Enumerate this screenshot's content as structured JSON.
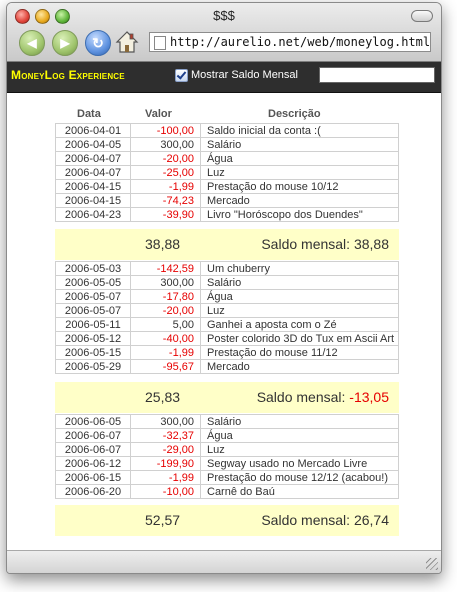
{
  "window": {
    "title": "$$$"
  },
  "browser": {
    "url": "http://aurelio.net/web/moneylog.html"
  },
  "app": {
    "brand": "MoneyLog Experience",
    "monthly_checkbox_label": "Mostrar Saldo Mensal",
    "monthly_checked": true,
    "filter_value": ""
  },
  "table_headers": {
    "date": "Data",
    "value": "Valor",
    "description": "Descrição"
  },
  "colors": {
    "negative": "#e60000",
    "total_bg": "#ffffc8",
    "appbar_bg": "#2e2e2e",
    "brand": "#ffff00"
  },
  "months": [
    {
      "rows": [
        {
          "date": "2006-04-01",
          "value": "-100,00",
          "negative": true,
          "desc": "Saldo inicial da conta :("
        },
        {
          "date": "2006-04-05",
          "value": "300,00",
          "negative": false,
          "desc": "Salário"
        },
        {
          "date": "2006-04-07",
          "value": "-20,00",
          "negative": true,
          "desc": "Água"
        },
        {
          "date": "2006-04-07",
          "value": "-25,00",
          "negative": true,
          "desc": "Luz"
        },
        {
          "date": "2006-04-15",
          "value": "-1,99",
          "negative": true,
          "desc": "Prestação do mouse 10/12"
        },
        {
          "date": "2006-04-15",
          "value": "-74,23",
          "negative": true,
          "desc": "Mercado"
        },
        {
          "date": "2006-04-23",
          "value": "-39,90",
          "negative": true,
          "desc": "Livro \"Horóscopo dos Duendes\""
        }
      ],
      "total": "38,88",
      "saldo_label": "Saldo mensal: ",
      "saldo": "38,88",
      "saldo_negative": false
    },
    {
      "rows": [
        {
          "date": "2006-05-03",
          "value": "-142,59",
          "negative": true,
          "desc": "Um chuberry"
        },
        {
          "date": "2006-05-05",
          "value": "300,00",
          "negative": false,
          "desc": "Salário"
        },
        {
          "date": "2006-05-07",
          "value": "-17,80",
          "negative": true,
          "desc": "Água"
        },
        {
          "date": "2006-05-07",
          "value": "-20,00",
          "negative": true,
          "desc": "Luz"
        },
        {
          "date": "2006-05-11",
          "value": "5,00",
          "negative": false,
          "desc": "Ganhei a aposta com o Zé"
        },
        {
          "date": "2006-05-12",
          "value": "-40,00",
          "negative": true,
          "desc": "Poster colorido 3D do Tux em Ascii Art"
        },
        {
          "date": "2006-05-15",
          "value": "-1,99",
          "negative": true,
          "desc": "Prestação do mouse 11/12"
        },
        {
          "date": "2006-05-29",
          "value": "-95,67",
          "negative": true,
          "desc": "Mercado"
        }
      ],
      "total": "25,83",
      "saldo_label": "Saldo mensal: ",
      "saldo": "-13,05",
      "saldo_negative": true
    },
    {
      "rows": [
        {
          "date": "2006-06-05",
          "value": "300,00",
          "negative": false,
          "desc": "Salário"
        },
        {
          "date": "2006-06-07",
          "value": "-32,37",
          "negative": true,
          "desc": "Água"
        },
        {
          "date": "2006-06-07",
          "value": "-29,00",
          "negative": true,
          "desc": "Luz"
        },
        {
          "date": "2006-06-12",
          "value": "-199,90",
          "negative": true,
          "desc": "Segway usado no Mercado Livre"
        },
        {
          "date": "2006-06-15",
          "value": "-1,99",
          "negative": true,
          "desc": "Prestação do mouse 12/12 (acabou!)"
        },
        {
          "date": "2006-06-20",
          "value": "-10,00",
          "negative": true,
          "desc": "Carnê do Baú"
        }
      ],
      "total": "52,57",
      "saldo_label": "Saldo mensal: ",
      "saldo": "26,74",
      "saldo_negative": false
    }
  ]
}
